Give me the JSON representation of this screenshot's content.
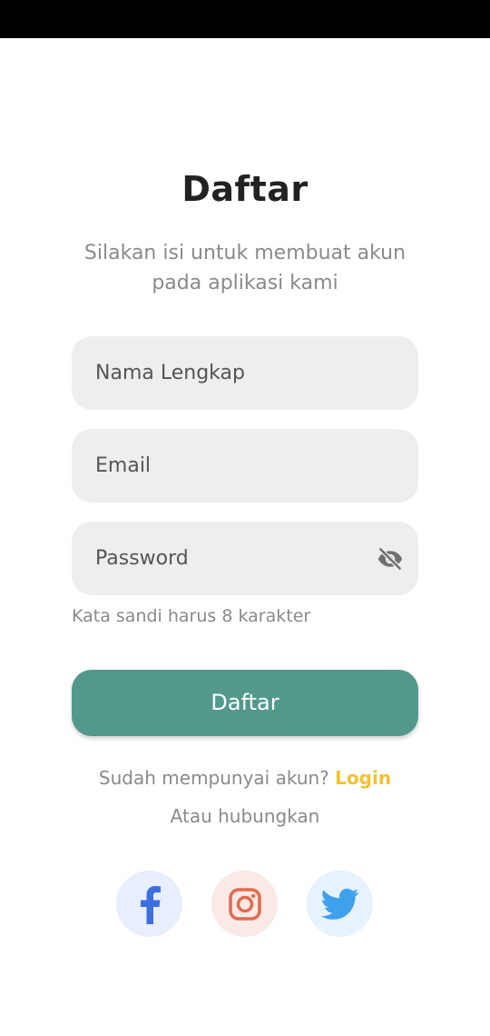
{
  "header": {
    "title": "Daftar",
    "subtitle": "Silakan isi untuk membuat akun pada aplikasi kami"
  },
  "form": {
    "full_name_placeholder": "Nama Lengkap",
    "email_placeholder": "Email",
    "password_placeholder": "Password",
    "password_icon": "eye-off-icon",
    "password_hint": "Kata sandi harus 8 karakter",
    "submit_label": "Daftar"
  },
  "footer": {
    "login_prompt": "Sudah mempunyai akun?",
    "login_link": "Login",
    "alt_text": "Atau hubungkan"
  },
  "social": [
    {
      "name": "facebook",
      "icon": "facebook-icon",
      "color": "#3b6fe0"
    },
    {
      "name": "instagram",
      "icon": "instagram-icon",
      "color": "#e06b4e"
    },
    {
      "name": "twitter",
      "icon": "twitter-icon",
      "color": "#3ea1ee"
    }
  ],
  "colors": {
    "accent": "#52998c",
    "link": "#f2c230",
    "field_bg": "#eeeeee"
  }
}
